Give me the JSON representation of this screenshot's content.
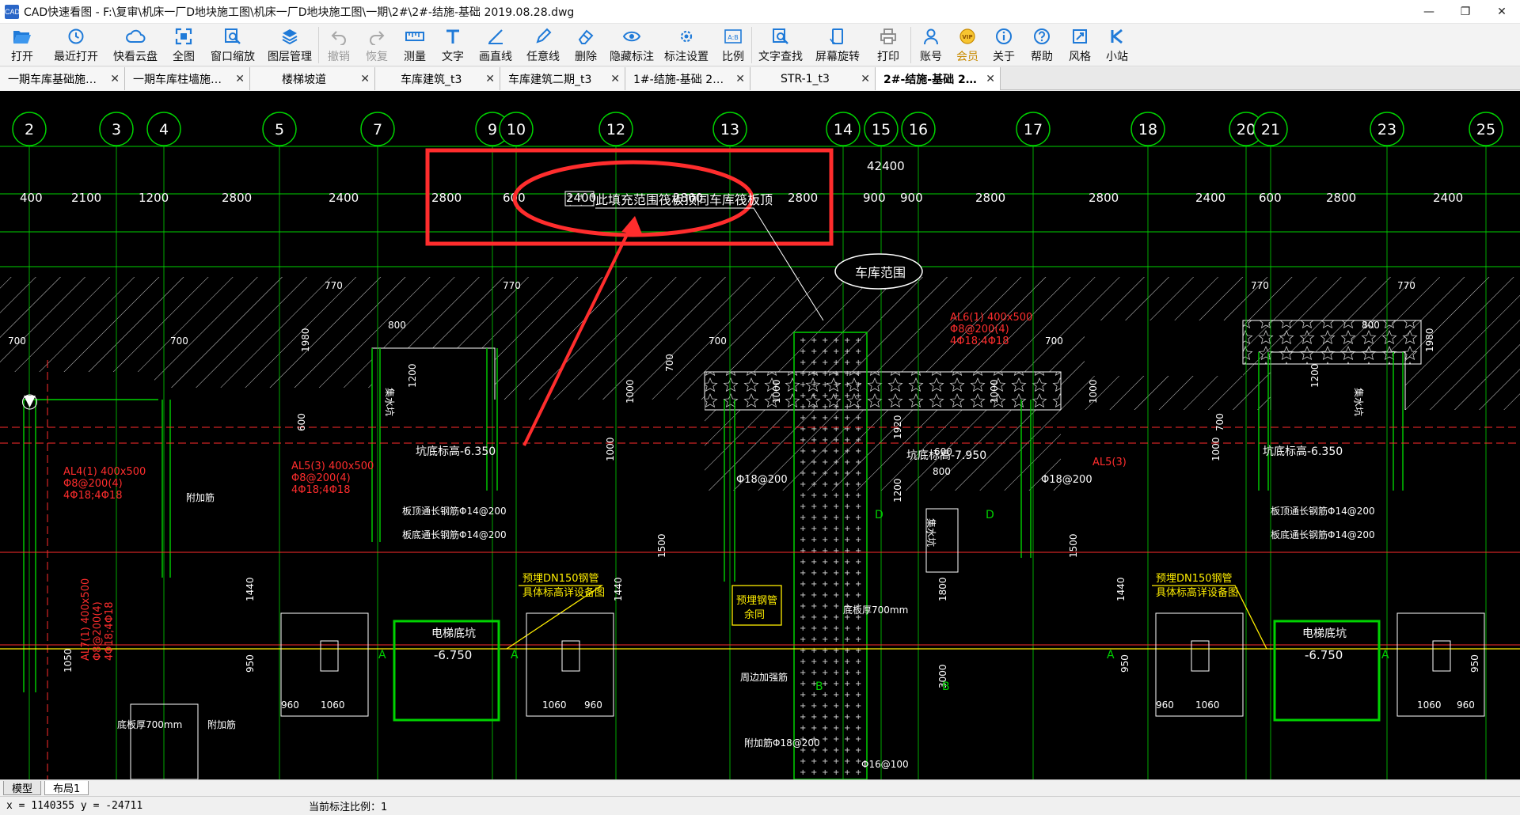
{
  "window": {
    "app_icon_label": "CAD",
    "title": "CAD快速看图 - F:\\复审\\机床一厂D地块施工图\\机床一厂D地块施工图\\一期\\2#\\2#-结施-基础 2019.08.28.dwg",
    "controls": {
      "minimize": "—",
      "maximize": "❐",
      "close": "✕"
    }
  },
  "toolbar": {
    "open": "打开",
    "recent": "最近打开",
    "cloud": "快看云盘",
    "full_view": "全图",
    "window_zoom": "窗口缩放",
    "layer_manage": "图层管理",
    "undo": "撤销",
    "redo": "恢复",
    "measure": "测量",
    "text": "文字",
    "line": "画直线",
    "freeline": "任意线",
    "delete": "删除",
    "hide_annot": "隐藏标注",
    "annot_settings": "标注设置",
    "scale": "比例",
    "text_search": "文字查找",
    "rotate": "屏幕旋转",
    "print": "打印",
    "account": "账号",
    "vip": "会员",
    "about": "关于",
    "help": "帮助",
    "style": "风格",
    "mini": "小站",
    "scale_icon_text": "A:B",
    "vip_icon_text": "VIP"
  },
  "tabs": [
    {
      "label": "一期车库基础施…",
      "close": "✕"
    },
    {
      "label": "一期车库柱墙施…",
      "close": "✕"
    },
    {
      "label": "楼梯坡道",
      "close": "✕"
    },
    {
      "label": "车库建筑_t3",
      "close": "✕"
    },
    {
      "label": "车库建筑二期_t3",
      "close": "✕"
    },
    {
      "label": "1#-结施-基础 2…",
      "close": "✕"
    },
    {
      "label": "STR-1_t3",
      "close": "✕"
    },
    {
      "label": "2#-结施-基础 2…",
      "close": "✕",
      "active": true
    }
  ],
  "drawing": {
    "axes": [
      "2",
      "3",
      "4",
      "5",
      "7",
      "9",
      "10",
      "12",
      "13",
      "14",
      "15",
      "16",
      "17",
      "18",
      "20",
      "21",
      "23",
      "25"
    ],
    "total_dim": "42400",
    "dims": [
      "400",
      "2100",
      "1200",
      "2800",
      "2400",
      "2800",
      "600",
      "2400",
      "2800",
      "2800",
      "900",
      "900",
      "2800",
      "2800",
      "2400",
      "600",
      "2800",
      "2400"
    ],
    "note_main": "此填充范围筏板顶同车库筏板顶",
    "garage_range": "车库范围",
    "pit_level_1": "坑底标高-6.350",
    "pit_level_2": "坑底标高-7.950",
    "pit_level_3": "坑底标高-6.350",
    "sump": "集水坑",
    "elevator_pit": "电梯底坑",
    "elevator_level": "-6.750",
    "pipe_note": "预埋DN150钢管",
    "pipe_note2": "具体标高详设备图",
    "pipe_note_mid": "预埋钢管",
    "pipe_note_mid2": "余同",
    "rebar_top": "板顶通长钢筋Φ14@200",
    "rebar_bottom": "板底通长钢筋Φ14@200",
    "beam_al4": "AL4(1) 400x500",
    "beam_al4_b": "Φ8@200(4)",
    "beam_al4_c": "4Φ18;4Φ18",
    "beam_al5": "AL5(3) 400x500",
    "beam_al5_b": "Φ8@200(4)",
    "beam_al5_c": "4Φ18;4Φ18",
    "beam_al6": "AL6(1) 400x500",
    "beam_al6_b": "Φ8@200(4)",
    "beam_al6_c": "4Φ18;4Φ18",
    "beam_al5_short": "AL5(3)",
    "beam_al7": "AL7(1) 400x500",
    "beam_al7_b": "Φ8@200(4)",
    "beam_al7_c": "4Φ18;4Φ18",
    "thick_note": "底板厚700mm",
    "added_rebar": "附加筋",
    "added_rebar2": "附加筋Φ18@200",
    "rebar_18": "Φ18@200",
    "rebar_16": "Φ16@100",
    "pit_rebar": "周边加强筋",
    "local_dims": [
      "770",
      "770",
      "770",
      "770",
      "800",
      "800",
      "700",
      "700",
      "700",
      "700",
      "1980",
      "1980",
      "1200",
      "1200",
      "1000",
      "1000",
      "1000",
      "1000",
      "1000",
      "1000",
      "960",
      "1060",
      "1060",
      "960",
      "960",
      "1060",
      "1060",
      "960",
      "1440",
      "1440",
      "1440",
      "950",
      "950",
      "950",
      "1050",
      "1500",
      "1500",
      "1800",
      "3000",
      "1200",
      "1920",
      "800",
      "600",
      "600",
      "700",
      "700"
    ],
    "axis_letters": [
      "A",
      "A",
      "A",
      "A",
      "B",
      "B",
      "D",
      "D"
    ]
  },
  "layout_tabs": {
    "model": "模型",
    "layout1": "布局1"
  },
  "status": {
    "coords": "x = 1140355  y = -24711",
    "scale_label": "当前标注比例：1"
  }
}
